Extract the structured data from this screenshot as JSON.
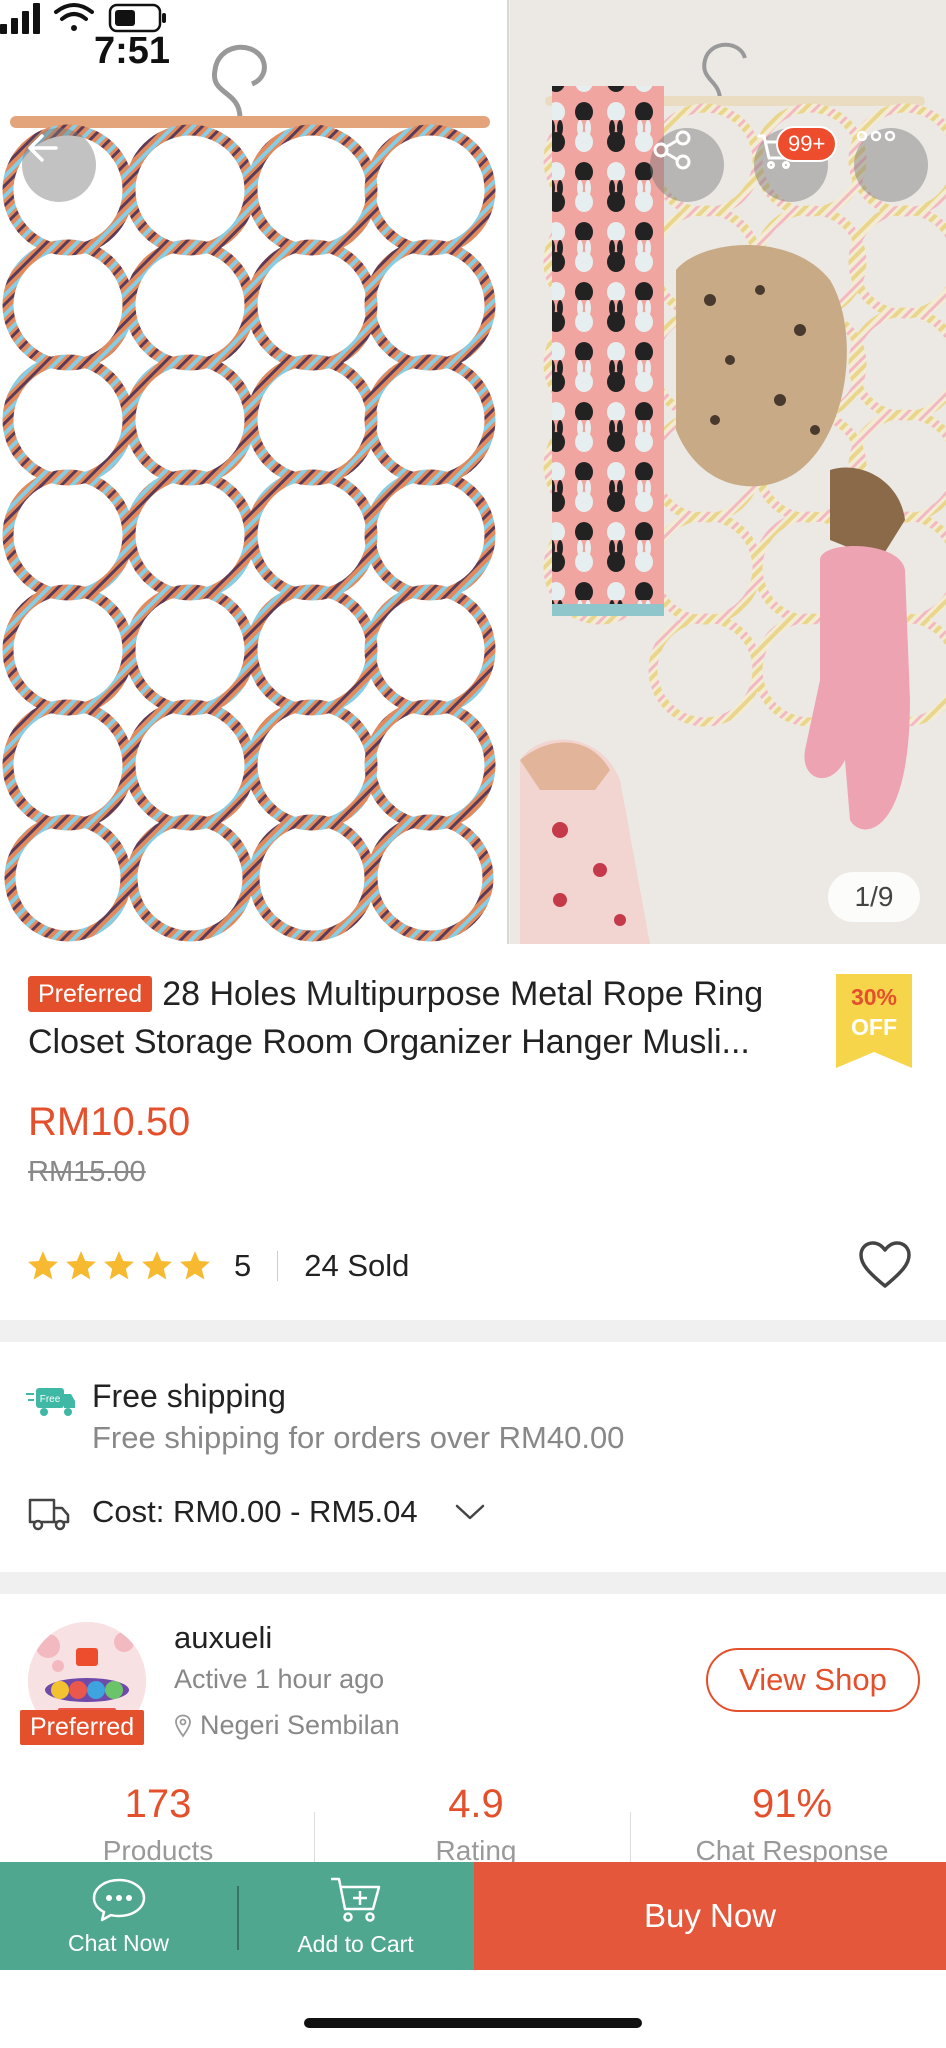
{
  "status_bar": {
    "time": "7:51"
  },
  "gallery": {
    "counter": "1/9",
    "cart_badge": "99+"
  },
  "product": {
    "preferred_tag": "Preferred",
    "title": "28 Holes Multipurpose Metal Rope Ring Closet Storage Room Organizer Hanger Musli...",
    "discount_pct": "30%",
    "discount_off": "OFF",
    "price": "RM10.50",
    "original_price": "RM15.00",
    "rating": "5",
    "stars": 5,
    "sold": "24 Sold"
  },
  "shipping": {
    "free_icon_text": "Free",
    "title": "Free shipping",
    "subtitle": "Free shipping for orders over RM40.00",
    "cost": "Cost: RM0.00 - RM5.04"
  },
  "shop": {
    "name": "auxueli",
    "active": "Active 1 hour ago",
    "location": "Negeri Sembilan",
    "preferred_label": "Preferred",
    "view_shop": "View Shop",
    "stats": [
      {
        "value": "173",
        "label": "Products"
      },
      {
        "value": "4.9",
        "label": "Rating"
      },
      {
        "value": "91%",
        "label": "Chat Response"
      }
    ]
  },
  "bottom_bar": {
    "chat_now": "Chat Now",
    "add_to_cart": "Add to Cart",
    "buy_now": "Buy Now"
  },
  "colors": {
    "accent": "#e4502c",
    "teal": "#4fa790",
    "star": "#f6b930",
    "discount": "#f7d54a"
  }
}
